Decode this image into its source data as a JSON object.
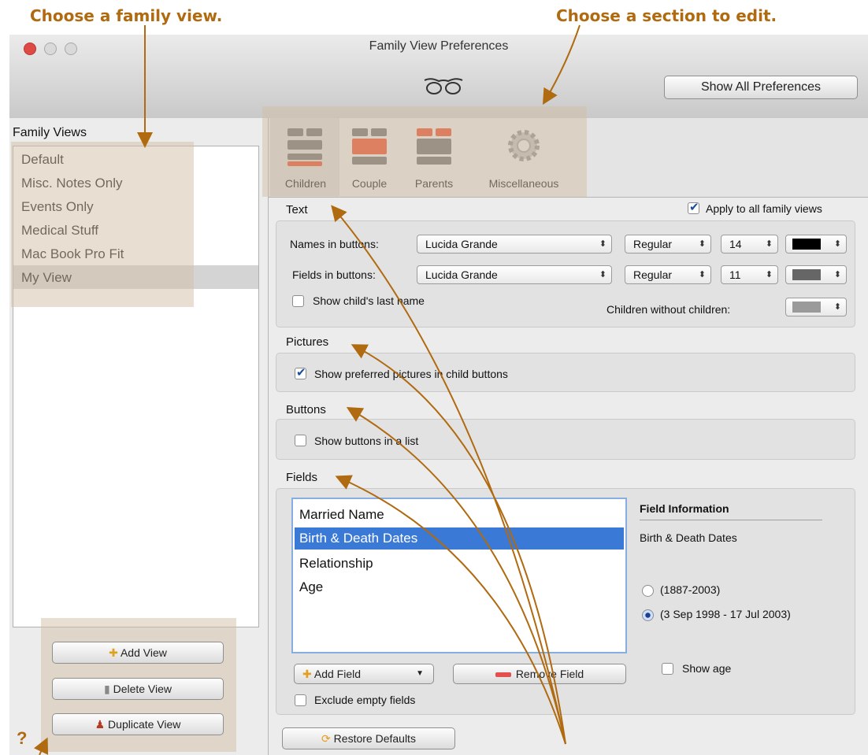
{
  "annotations": {
    "family_view": "Choose a family view.",
    "section": "Choose a section to edit."
  },
  "window": {
    "title": "Family View Preferences",
    "show_all_button": "Show All Preferences"
  },
  "sidebar": {
    "heading": "Family Views",
    "views": [
      "Default",
      "Misc. Notes Only",
      "Events Only",
      "Medical Stuff",
      "Mac Book Pro Fit",
      "My View"
    ],
    "selected": "My View",
    "add_label": "Add View",
    "delete_label": "Delete View",
    "duplicate_label": "Duplicate View",
    "help": "?"
  },
  "toolbar": {
    "tabs": [
      "Children",
      "Couple",
      "Parents",
      "Miscellaneous"
    ],
    "selected": "Children"
  },
  "text_section": {
    "title": "Text",
    "apply_all": "Apply to all family views",
    "names_label": "Names in buttons:",
    "names_font": "Lucida Grande",
    "names_style": "Regular",
    "names_size": "14",
    "names_color": "#000000",
    "fields_label": "Fields in buttons:",
    "fields_font": "Lucida Grande",
    "fields_style": "Regular",
    "fields_size": "11",
    "fields_color": "#666666",
    "show_last_name": "Show child's last name",
    "without_children_label": "Children without children:",
    "without_children_color": "#9a9a9a"
  },
  "pictures_section": {
    "title": "Pictures",
    "show_preferred": "Show preferred pictures in child buttons"
  },
  "buttons_section": {
    "title": "Buttons",
    "show_list": "Show buttons in a list"
  },
  "fields_section": {
    "title": "Fields",
    "items": [
      "Married Name",
      "Birth & Death Dates",
      "Relationship",
      "Age"
    ],
    "selected": "Birth & Death Dates",
    "info_heading": "Field Information",
    "info_name": "Birth & Death Dates",
    "radio_1": "(1887-2003)",
    "radio_2": "(3 Sep 1998 - 17 Jul 2003)",
    "show_age": "Show age",
    "add_field": "Add Field",
    "remove_field": "Remove Field",
    "exclude_empty": "Exclude empty fields"
  },
  "restore_defaults": "Restore Defaults"
}
